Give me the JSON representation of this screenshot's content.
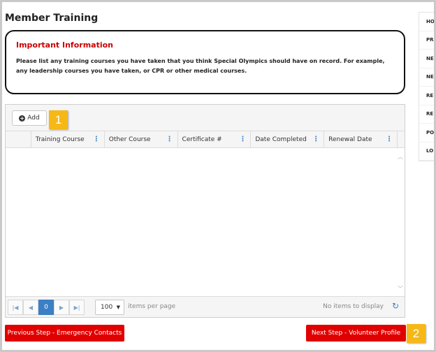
{
  "page": {
    "title": "Member Training"
  },
  "info": {
    "title": "Important Information",
    "text": "Please list any training courses you have taken that you think Special Olympics should have on record. For example, any leadership courses you have taken, or CPR or other medical courses."
  },
  "grid": {
    "add_label": "Add",
    "columns": [
      "Training Course",
      "Other Course",
      "Certificate #",
      "Date Completed",
      "Renewal Date"
    ],
    "pager": {
      "current_page": "0",
      "page_size": "100",
      "per_page_label": "items per page",
      "empty_message": "No items to display"
    }
  },
  "callouts": {
    "first": "1",
    "second": "2"
  },
  "buttons": {
    "previous": "Previous Step - Emergency Contacts",
    "next": "Next Step - Volunteer Profile"
  },
  "side_nav": {
    "items": [
      "HO",
      "PR",
      "NE",
      "NE",
      "RE",
      "RE",
      "PO",
      "LO"
    ]
  },
  "icons": {
    "add": "plus-circle-icon",
    "column_menu": "kebab-icon",
    "first": "first-page-icon",
    "prev": "prev-page-icon",
    "next": "next-page-icon",
    "last": "last-page-icon",
    "refresh": "refresh-icon"
  },
  "colors": {
    "accent": "#3b7fc4",
    "danger": "#e00000",
    "callout": "#f6b817",
    "info_title": "#cc0000"
  }
}
